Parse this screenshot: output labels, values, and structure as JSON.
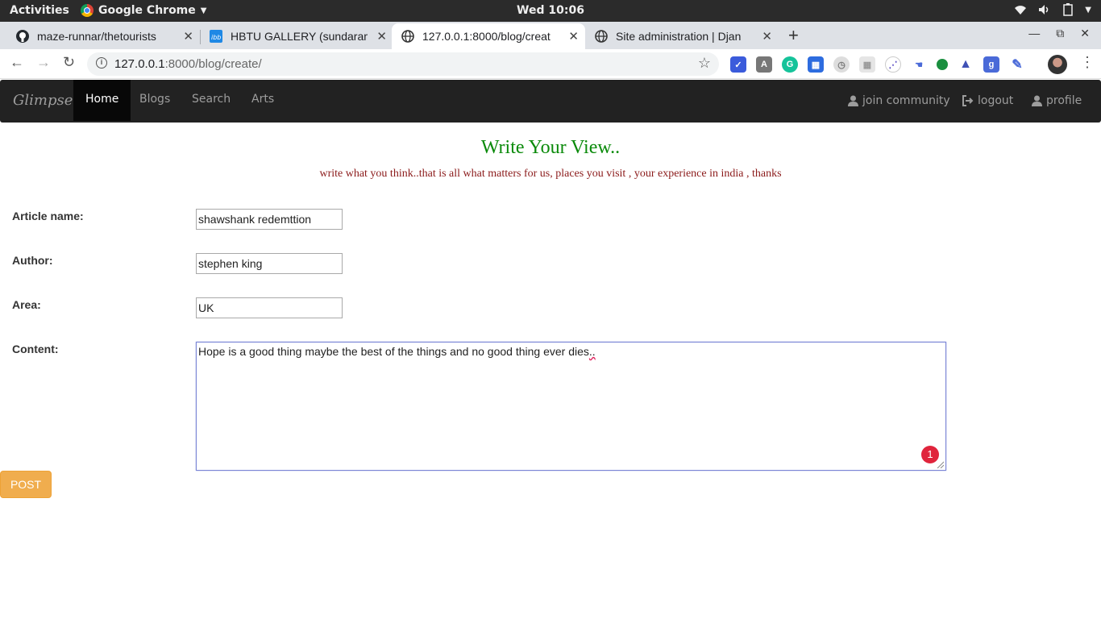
{
  "os": {
    "activities": "Activities",
    "app_name": "Google Chrome",
    "clock": "Wed 10:06"
  },
  "browser": {
    "tabs": [
      {
        "title": "maze-runnar/thetourists",
        "favicon": "github-icon"
      },
      {
        "title": "HBTU GALLERY (sundaram",
        "favicon": "ibb-icon"
      },
      {
        "title": "127.0.0.1:8000/blog/creat",
        "favicon": "globe-icon"
      },
      {
        "title": "Site administration | Djan",
        "favicon": "globe-icon"
      }
    ],
    "url_host": "127.0.0.1",
    "url_path": ":8000/blog/create/"
  },
  "site": {
    "brand": "Glimpse",
    "nav": [
      "Home",
      "Blogs",
      "Search",
      "Arts"
    ],
    "nav_right": {
      "join": "join community",
      "logout": "logout",
      "profile": "profile"
    },
    "heading": "Write Your View..",
    "subheading": "write what you think..that is all what matters for us, places you visit , your experience in india , thanks"
  },
  "form": {
    "article_label": "Article name:",
    "article_value": "shawshank redemttion",
    "author_label": "Author:",
    "author_value": "stephen king",
    "area_label": "Area:",
    "area_value": "UK",
    "content_label": "Content:",
    "content_value": "Hope is a good thing maybe the best of the things and no good thing ever dies",
    "content_misspelled": "..",
    "grammar_badge": "1",
    "post_label": "POST"
  },
  "colors": {
    "heading": "#0a8a0a",
    "subheading": "#8b1a1a",
    "navbar": "#222222",
    "post_button": "#f0ad4e"
  }
}
